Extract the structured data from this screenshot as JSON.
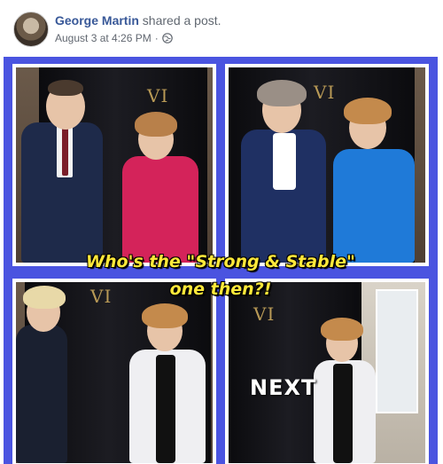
{
  "post": {
    "author": "George Martin",
    "action": "shared a post.",
    "timestamp": "August 3 at 4:26 PM",
    "separator": "·",
    "privacy_icon": "globe-icon"
  },
  "image": {
    "caption_line1": "Who's the \"Strong & Stable\"",
    "caption_line2": "one then?!",
    "panel_numeral": "VI",
    "next_label": "NEXT"
  },
  "colors": {
    "frame": "#4a54e0",
    "caption": "#ffe93a",
    "author_link": "#385898"
  }
}
